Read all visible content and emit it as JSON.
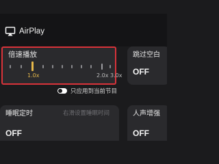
{
  "airplay": {
    "label": "AirPlay",
    "icon": "airplay-icon"
  },
  "speed": {
    "title": "倍速播放",
    "current_label": "1.0x",
    "max_labels": "2.0x 3.0x",
    "current": 1.0
  },
  "skip_blank": {
    "title": "跳过空白",
    "value": "OFF"
  },
  "apply_current": {
    "label": "只应用到当前节目",
    "enabled": false
  },
  "sleep_timer": {
    "title": "睡眠定时",
    "hint": "右滑设置睡眠时间",
    "value": "OFF"
  },
  "voice_boost": {
    "title": "人声增强",
    "value": "OFF"
  },
  "colors": {
    "accent": "#e6b84a",
    "highlight_border": "#d9333a",
    "card": "#2a2a2d",
    "background": "#1b1b1d"
  }
}
